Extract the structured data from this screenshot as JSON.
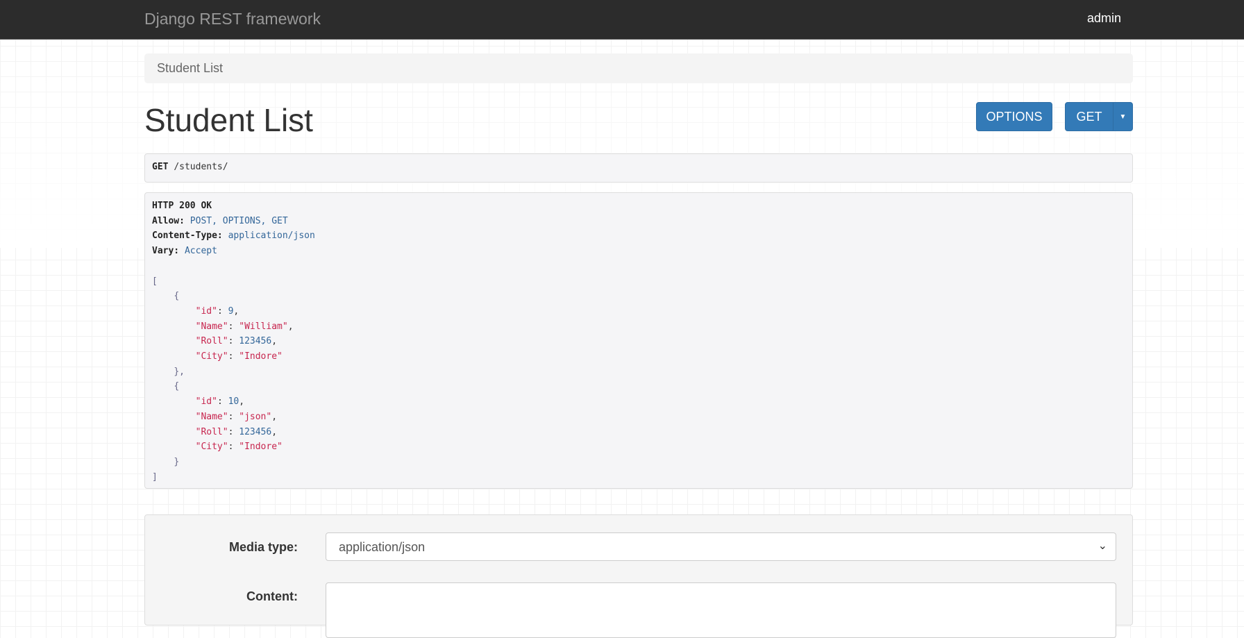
{
  "navbar": {
    "brand": "Django REST framework",
    "user": "admin"
  },
  "breadcrumb": "Student List",
  "page_title": "Student List",
  "buttons": {
    "options": "OPTIONS",
    "get": "GET"
  },
  "request": {
    "method": "GET",
    "path": "/students/"
  },
  "response": {
    "status": "HTTP 200 OK",
    "headers": [
      {
        "name": "Allow:",
        "value": "POST, OPTIONS, GET"
      },
      {
        "name": "Content-Type:",
        "value": "application/json"
      },
      {
        "name": "Vary:",
        "value": "Accept"
      }
    ],
    "items": [
      {
        "id": "9",
        "Name": "\"William\"",
        "Roll": "123456",
        "City": "\"Indore\""
      },
      {
        "id": "10",
        "Name": "\"json\"",
        "Roll": "123456",
        "City": "\"Indore\""
      }
    ]
  },
  "form": {
    "media_type_label": "Media type:",
    "media_type_value": "application/json",
    "content_label": "Content:"
  }
}
